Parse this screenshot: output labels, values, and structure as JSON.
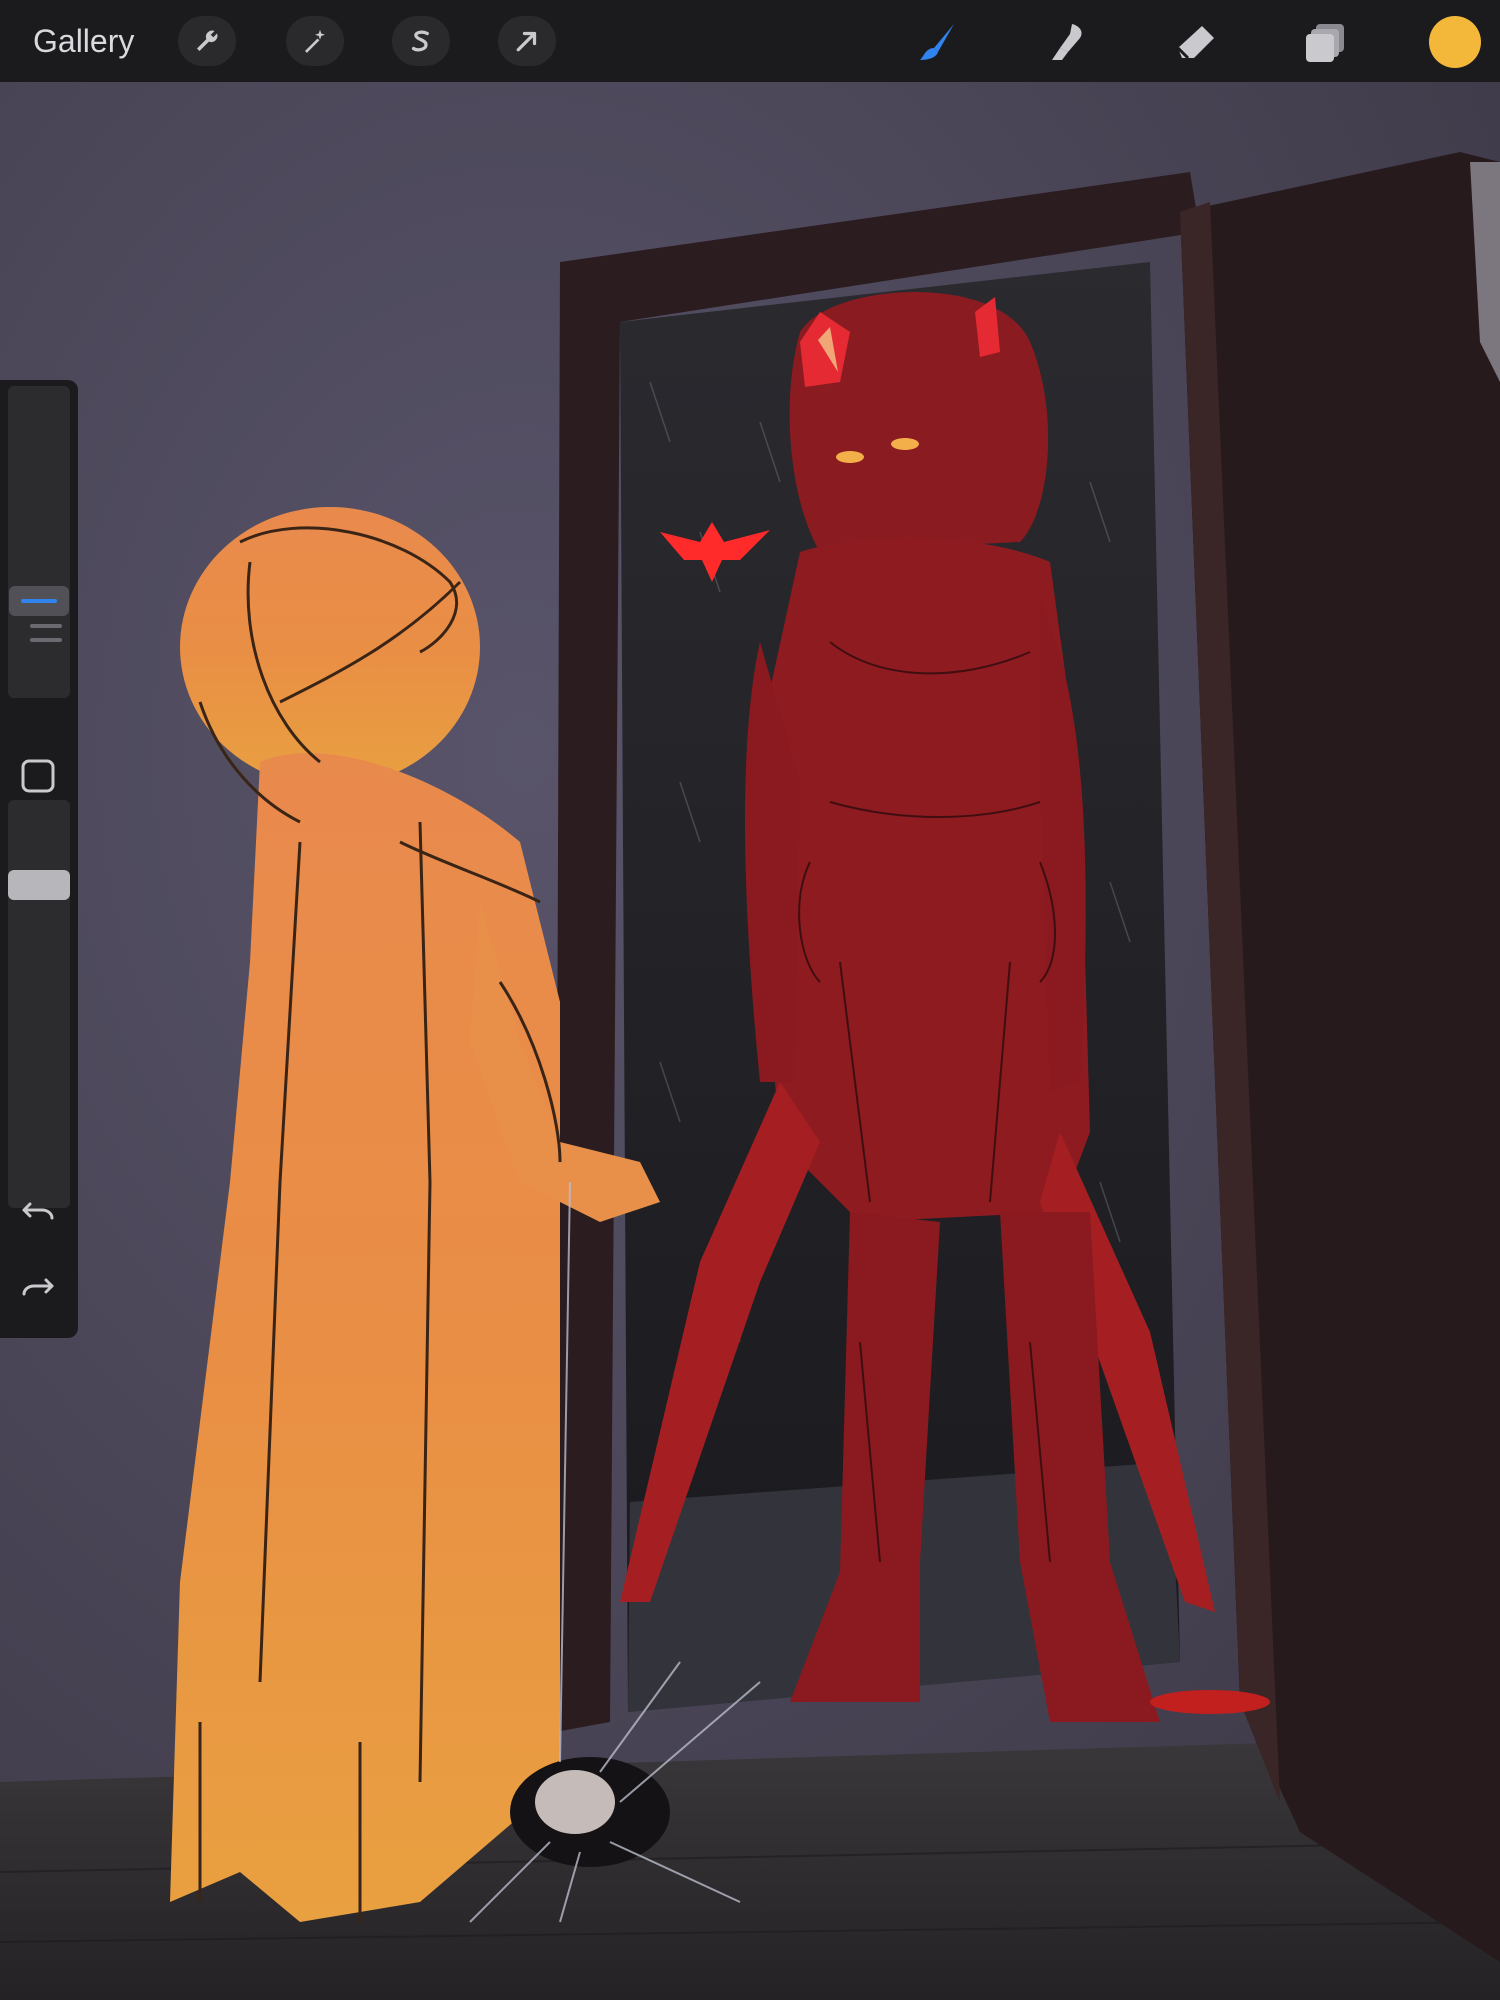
{
  "toolbar": {
    "gallery_label": "Gallery",
    "left_tools": [
      {
        "name": "adjustments-wrench-icon"
      },
      {
        "name": "adjustments-magic-wand-icon"
      },
      {
        "name": "selection-s-icon"
      },
      {
        "name": "transform-arrow-icon"
      }
    ],
    "right_tools": [
      {
        "name": "brush-icon",
        "active": true
      },
      {
        "name": "smudge-icon",
        "active": false
      },
      {
        "name": "eraser-icon",
        "active": false
      },
      {
        "name": "layers-icon",
        "active": false
      }
    ],
    "current_color": "#f3b83a",
    "active_tool_color": "#2f84f0",
    "icon_color": "#c9c9ce"
  },
  "sidebar": {
    "icons": [
      "modify-square-icon",
      "undo-arrow-icon",
      "redo-arrow-icon"
    ],
    "size_handle_color": "#2f84f0"
  },
  "canvas": {
    "wall_color": "#4b4756",
    "door_frame_color": "#2b1c1e",
    "doorway_color": "#1f1f23",
    "floor_color": "#2e2c2f",
    "orange_figure_color": "#e8863f",
    "red_figure_color": "#8e1b1f",
    "accent_red": "#ff2a2a"
  }
}
